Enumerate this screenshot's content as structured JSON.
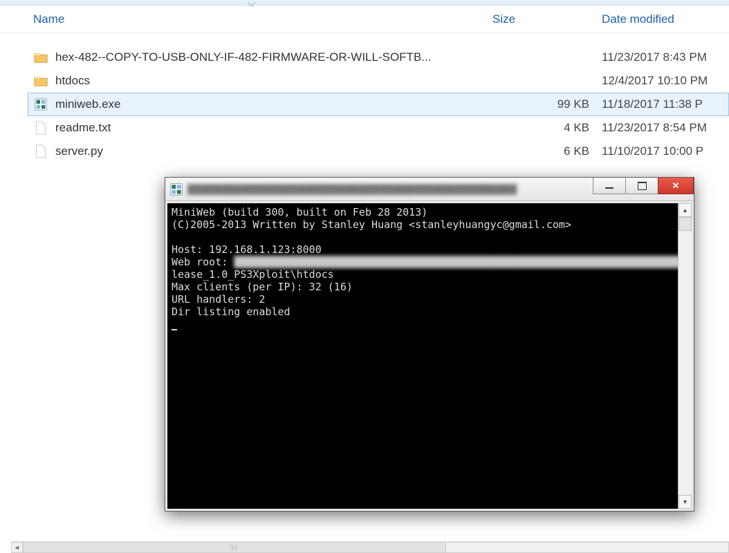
{
  "explorer": {
    "columns": {
      "name": "Name",
      "size": "Size",
      "date": "Date modified"
    },
    "rows": [
      {
        "type": "folder",
        "name": "hex-482--COPY-TO-USB-ONLY-IF-482-FIRMWARE-OR-WILL-SOFTB...",
        "size": "",
        "date": "11/23/2017 8:43 PM"
      },
      {
        "type": "folder",
        "name": "htdocs",
        "size": "",
        "date": "12/4/2017 10:10 PM"
      },
      {
        "type": "exe",
        "name": "miniweb.exe",
        "size": "99 KB",
        "date": "11/18/2017 11:38 P",
        "selected": true
      },
      {
        "type": "file",
        "name": "readme.txt",
        "size": "4 KB",
        "date": "11/23/2017 8:54 PM"
      },
      {
        "type": "file",
        "name": "server.py",
        "size": "6 KB",
        "date": "11/10/2017 10:00 P"
      }
    ]
  },
  "console": {
    "lines": {
      "l1": "MiniWeb (build 300, built on Feb 28 2013)",
      "l2": "(C)2005-2013 Written by Stanley Huang <stanleyhuangyc@gmail.com>",
      "l3": "",
      "l4": "Host: 192.168.1.123:8000",
      "l5a": "Web root: ",
      "l6": "lease_1.0_PS3Xploit\\htdocs",
      "l7": "Max clients (per IP): 32 (16)",
      "l8": "URL handlers: 2",
      "l9": "Dir listing enabled"
    }
  }
}
